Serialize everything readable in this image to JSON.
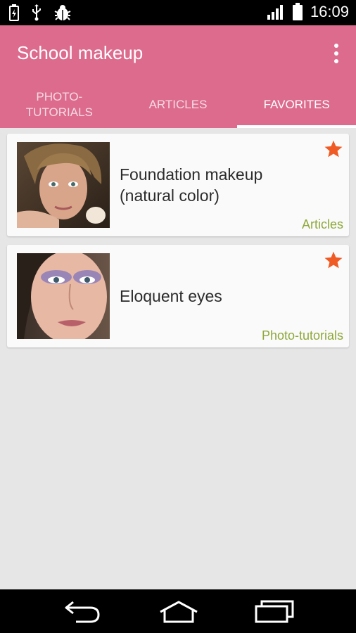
{
  "status_bar": {
    "time": "16:09",
    "left_icons": [
      "battery-saver-icon",
      "usb-icon",
      "bug-icon"
    ],
    "right_icons": [
      "signal-icon",
      "battery-icon"
    ]
  },
  "app_bar": {
    "title": "School makeup",
    "menu_icon": "overflow-menu-icon",
    "background": "#dc6b8e"
  },
  "tabs": [
    {
      "label_line1": "PHOTO-",
      "label_line2": "TUTORIALS",
      "active": false
    },
    {
      "label": "ARTICLES",
      "active": false
    },
    {
      "label": "FAVORITES",
      "active": true
    }
  ],
  "favorites": [
    {
      "title_line1": "Foundation makeup",
      "title_line2": "(natural color)",
      "category": "Articles",
      "starred": true,
      "thumb_icon": "woman-portrait-thumbnail"
    },
    {
      "title_line1": "Eloquent eyes",
      "title_line2": "",
      "category": "Photo-tutorials",
      "starred": true,
      "thumb_icon": "eye-makeup-thumbnail"
    }
  ],
  "colors": {
    "accent": "#dc6b8e",
    "star": "#f05a24",
    "category": "#8ea83a"
  },
  "nav_bar": {
    "buttons": [
      "back-icon",
      "home-icon",
      "recents-icon"
    ]
  }
}
